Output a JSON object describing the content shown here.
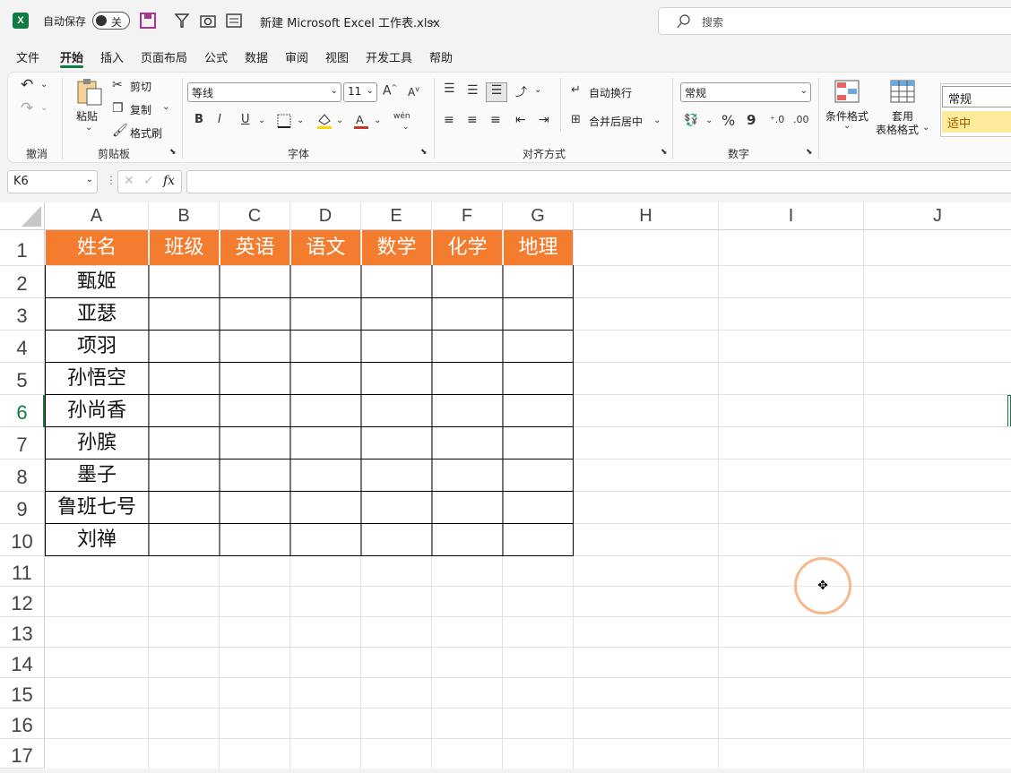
{
  "titlebar": {
    "autosave_label": "自动保存",
    "autosave_state": "关",
    "filename": "新建 Microsoft Excel 工作表.xlsx",
    "search_placeholder": "搜索"
  },
  "menu": [
    "文件",
    "开始",
    "插入",
    "页面布局",
    "公式",
    "数据",
    "审阅",
    "视图",
    "开发工具",
    "帮助"
  ],
  "ribbon": {
    "undo_group": "撤消",
    "clipboard": {
      "paste": "粘贴",
      "cut": "剪切",
      "copy": "复制",
      "format_painter": "格式刷",
      "group": "剪贴板"
    },
    "font": {
      "name": "等线",
      "size": "11",
      "bold": "B",
      "italic": "I",
      "underline": "U",
      "phonetic": "wén",
      "group": "字体"
    },
    "alignment": {
      "wrap": "自动换行",
      "merge": "合并后居中",
      "group": "对齐方式"
    },
    "number": {
      "format": "常规",
      "percent": "%",
      "comma": "9",
      "group": "数字"
    },
    "styles": {
      "conditional": "条件格式",
      "table1": "套用",
      "table2": "表格格式",
      "normal": "常规",
      "neutral": "适中"
    }
  },
  "formula": {
    "namebox": "K6",
    "fx": "fx"
  },
  "columns": [
    "A",
    "B",
    "C",
    "D",
    "E",
    "F",
    "G",
    "H",
    "I",
    "J"
  ],
  "rows": [
    "1",
    "2",
    "3",
    "4",
    "5",
    "6",
    "7",
    "8",
    "9",
    "10",
    "11",
    "12",
    "13",
    "14",
    "15",
    "16",
    "17"
  ],
  "table": {
    "headers": [
      "姓名",
      "班级",
      "英语",
      "语文",
      "数学",
      "化学",
      "地理"
    ],
    "names": [
      "甄姬",
      "亚瑟",
      "项羽",
      "孙悟空",
      "孙尚香",
      "孙膑",
      "墨子",
      "鲁班七号",
      "刘禅"
    ]
  },
  "colors": {
    "header_fill": "#f47c2f",
    "accent": "#107c41"
  }
}
